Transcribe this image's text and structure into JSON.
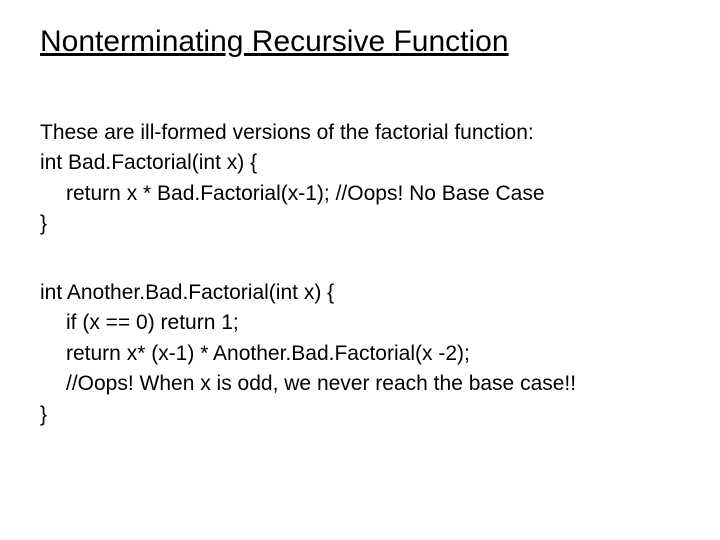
{
  "title": "Nonterminating Recursive Function",
  "intro": "These are ill-formed versions of the factorial function:",
  "block1": {
    "line1": "int Bad.Factorial(int x) {",
    "line2": "return x * Bad.Factorial(x-1); //Oops! No Base Case",
    "line3": "}"
  },
  "block2": {
    "line1": "int Another.Bad.Factorial(int x) {",
    "line2": "if (x == 0) return 1;",
    "line3": " return x* (x-1) *  Another.Bad.Factorial(x -2);",
    "line4": "//Oops! When x is odd, we never reach the base case!!",
    "line5": "}"
  }
}
